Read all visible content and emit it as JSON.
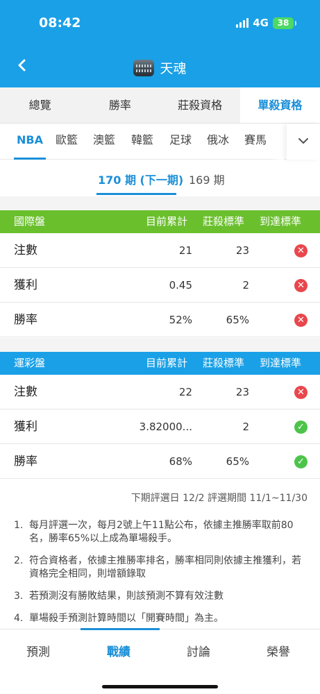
{
  "status_bar": {
    "time": "08:42",
    "network": "4G",
    "battery": "38"
  },
  "header": {
    "title": "天魂"
  },
  "tabs": [
    {
      "label": "總覽"
    },
    {
      "label": "勝率"
    },
    {
      "label": "莊殺資格"
    },
    {
      "label": "單殺資格"
    }
  ],
  "active_tab": "單殺資格",
  "leagues": [
    "NBA",
    "歐籃",
    "澳籃",
    "韓籃",
    "足球",
    "俄冰",
    "賽馬"
  ],
  "active_league": "NBA",
  "periods": [
    {
      "label": "170 期 (下一期)"
    },
    {
      "label": "169 期"
    }
  ],
  "columns": {
    "current": "目前累計",
    "standard": "莊殺標準",
    "reached": "到達標準"
  },
  "tables": [
    {
      "name": "國際盤",
      "color": "#6abf2d",
      "rows": [
        {
          "label": "注數",
          "current": "21",
          "standard": "23",
          "reached": false
        },
        {
          "label": "獲利",
          "current": "0.45",
          "standard": "2",
          "reached": false
        },
        {
          "label": "勝率",
          "current": "52%",
          "standard": "65%",
          "reached": false
        }
      ]
    },
    {
      "name": "運彩盤",
      "color": "#1aa0e6",
      "rows": [
        {
          "label": "注數",
          "current": "22",
          "standard": "23",
          "reached": false
        },
        {
          "label": "獲利",
          "current": "3.82000...",
          "standard": "2",
          "reached": true
        },
        {
          "label": "勝率",
          "current": "68%",
          "standard": "65%",
          "reached": true
        }
      ]
    }
  ],
  "eval_period": "下期評選日 12/2 評選期間 11/1~11/30",
  "notes": [
    {
      "num": "1.",
      "text": "每月評選一次，每月2號上午11點公布，依據主推勝率取前80名，勝率65%以上成為單場殺手。"
    },
    {
      "num": "2.",
      "text": "符合資格者，依據主推勝率排名，勝率相同則依據主推獲利，若資格完全相同，則增額錄取"
    },
    {
      "num": "3.",
      "text": "若預測沒有勝敗結果，則該預測不算有效注數"
    },
    {
      "num": "4.",
      "text": "單場殺手預測計算時間以「開賽時間」為主。"
    }
  ],
  "bottom_nav": [
    {
      "label": "預測"
    },
    {
      "label": "戰績"
    },
    {
      "label": "討論"
    },
    {
      "label": "榮譽"
    }
  ],
  "active_nav": "戰績",
  "colors": {
    "primary": "#1aa0e6",
    "accent_text": "#1a8fd8",
    "fail": "#e8474d",
    "pass": "#4cc44a"
  }
}
